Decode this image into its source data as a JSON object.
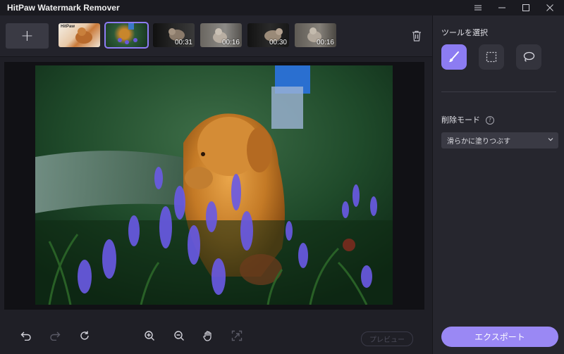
{
  "window": {
    "title": "HitPaw Watermark Remover",
    "controls": [
      "menu-icon",
      "minimize-icon",
      "maximize-icon",
      "close-icon"
    ]
  },
  "thumbnails": {
    "add_label": "+",
    "items": [
      {
        "name": "thumb-1",
        "duration": "",
        "selected": false,
        "caption": "HitPaw"
      },
      {
        "name": "thumb-2",
        "duration": "",
        "selected": true,
        "caption": ""
      },
      {
        "name": "thumb-3",
        "duration": "00:31",
        "selected": false,
        "caption": ""
      },
      {
        "name": "thumb-4",
        "duration": "00:16",
        "selected": false,
        "caption": ""
      },
      {
        "name": "thumb-5",
        "duration": "00:30",
        "selected": false,
        "caption": ""
      },
      {
        "name": "thumb-6",
        "duration": "00:16",
        "selected": false,
        "caption": ""
      }
    ]
  },
  "bottom_toolbar": {
    "tools": [
      "undo-icon",
      "redo-icon",
      "reset-icon",
      "zoom-in-icon",
      "zoom-out-icon",
      "hand-icon",
      "fit-icon"
    ],
    "preview_label": "プレビュー"
  },
  "right_panel": {
    "tools_heading": "ツールを選択",
    "tools": [
      "brush-tool",
      "rectangle-select-tool",
      "lasso-tool"
    ],
    "mode_heading": "削除モード",
    "mode_help": "?",
    "mode_value": "滑らかに塗りつぶす",
    "export_label": "エクスポート"
  },
  "colors": {
    "accent": "#8c7cf2",
    "export": "#9a88f4"
  }
}
